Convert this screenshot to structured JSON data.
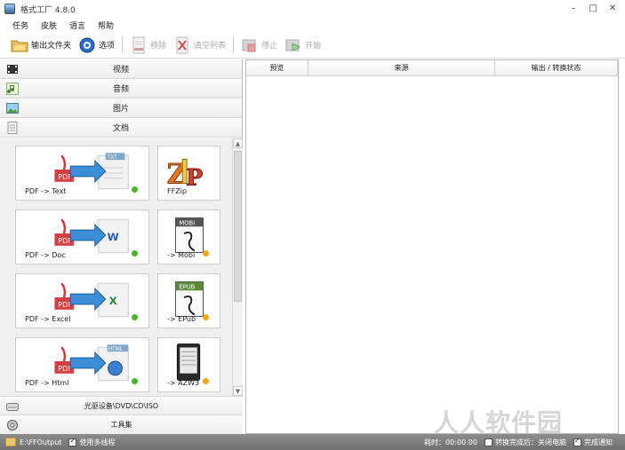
{
  "window": {
    "title": "格式工厂 4.8.0",
    "controls": [
      "–",
      "□",
      "✕"
    ]
  },
  "menu": [
    "任务",
    "皮肤",
    "语言",
    "帮助"
  ],
  "toolbar": {
    "output_folder": "输出文件夹",
    "options": "选项",
    "remove": "移除",
    "clear_list": "清空列表",
    "stop": "停止",
    "start": "开始"
  },
  "categories": {
    "video": "视频",
    "audio": "音频",
    "picture": "图片",
    "document": "文档",
    "optical": "光驱设备\\DVD\\CD\\ISO",
    "toolbox": "工具集"
  },
  "tiles": [
    {
      "label": "PDF -> Text",
      "status_color": "#4caf28"
    },
    {
      "label": "FFZip",
      "status_color": ""
    },
    {
      "label": "PDF -> Doc",
      "status_color": "#4caf28"
    },
    {
      "label": "-> Mobi",
      "status_color": "#f0a818"
    },
    {
      "label": "PDF -> Excel",
      "status_color": "#4caf28"
    },
    {
      "label": "-> EPub",
      "status_color": "#f0a818"
    },
    {
      "label": "PDF -> Html",
      "status_color": "#4caf28"
    },
    {
      "label": "-> AZW3",
      "status_color": "#f0a818"
    }
  ],
  "tile_art": {
    "text_badge": "TXT",
    "doc_badge": "W",
    "excel_badge": "X",
    "html_badge": "HTML",
    "pdf_badge": "PDF",
    "mobi_badge": "MOBI",
    "epub_badge": "EPUB"
  },
  "table": {
    "columns": [
      "预览",
      "来源",
      "输出 / 转换状态"
    ]
  },
  "statusbar": {
    "output_path": "E:\\FFOutput",
    "multithread": "使用多线程",
    "elapsed": "耗时：00:00:00",
    "after_convert": "转换完成后：关闭电脑",
    "notify": "完成通知"
  },
  "watermark": "人人软件园"
}
